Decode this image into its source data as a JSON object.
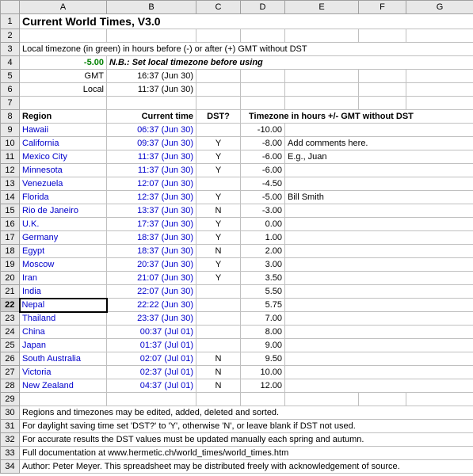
{
  "columns": [
    "A",
    "B",
    "C",
    "D",
    "E",
    "F",
    "G"
  ],
  "title": "Current World Times, V3.0",
  "note_line3": "Local timezone (in green) in hours before (-) or after (+) GMT without DST",
  "local_tz_value": "-5.00",
  "nb_text": "N.B.: Set local timezone before using",
  "gmt_label": "GMT",
  "gmt_time": "16:37 (Jun 30)",
  "local_label": "Local",
  "local_time": "11:37 (Jun 30)",
  "headers": {
    "region": "Region",
    "curtime": "Current time",
    "dst": "DST?",
    "tz": "Timezone in hours +/- GMT without DST"
  },
  "rows": [
    {
      "rn": "9",
      "region": "Hawaii",
      "time": "06:37 (Jun 30)",
      "dst": "",
      "tz": "-10.00",
      "comment": ""
    },
    {
      "rn": "10",
      "region": "California",
      "time": "09:37 (Jun 30)",
      "dst": "Y",
      "tz": "-8.00",
      "comment": "Add comments here."
    },
    {
      "rn": "11",
      "region": "Mexico City",
      "time": "11:37 (Jun 30)",
      "dst": "Y",
      "tz": "-6.00",
      "comment": "E.g., Juan"
    },
    {
      "rn": "12",
      "region": "Minnesota",
      "time": "11:37 (Jun 30)",
      "dst": "Y",
      "tz": "-6.00",
      "comment": ""
    },
    {
      "rn": "13",
      "region": "Venezuela",
      "time": "12:07 (Jun 30)",
      "dst": "",
      "tz": "-4.50",
      "comment": ""
    },
    {
      "rn": "14",
      "region": "Florida",
      "time": "12:37 (Jun 30)",
      "dst": "Y",
      "tz": "-5.00",
      "comment": "Bill Smith"
    },
    {
      "rn": "15",
      "region": "Rio de Janeiro",
      "time": "13:37 (Jun 30)",
      "dst": "N",
      "tz": "-3.00",
      "comment": ""
    },
    {
      "rn": "16",
      "region": "U.K.",
      "time": "17:37 (Jun 30)",
      "dst": "Y",
      "tz": "0.00",
      "comment": ""
    },
    {
      "rn": "17",
      "region": "Germany",
      "time": "18:37 (Jun 30)",
      "dst": "Y",
      "tz": "1.00",
      "comment": ""
    },
    {
      "rn": "18",
      "region": "Egypt",
      "time": "18:37 (Jun 30)",
      "dst": "N",
      "tz": "2.00",
      "comment": ""
    },
    {
      "rn": "19",
      "region": "Moscow",
      "time": "20:37 (Jun 30)",
      "dst": "Y",
      "tz": "3.00",
      "comment": ""
    },
    {
      "rn": "20",
      "region": "Iran",
      "time": "21:07 (Jun 30)",
      "dst": "Y",
      "tz": "3.50",
      "comment": ""
    },
    {
      "rn": "21",
      "region": "India",
      "time": "22:07 (Jun 30)",
      "dst": "",
      "tz": "5.50",
      "comment": ""
    },
    {
      "rn": "22",
      "region": "Nepal",
      "time": "22:22 (Jun 30)",
      "dst": "",
      "tz": "5.75",
      "comment": ""
    },
    {
      "rn": "23",
      "region": "Thailand",
      "time": "23:37 (Jun 30)",
      "dst": "",
      "tz": "7.00",
      "comment": ""
    },
    {
      "rn": "24",
      "region": "China",
      "time": "00:37 (Jul 01)",
      "dst": "",
      "tz": "8.00",
      "comment": ""
    },
    {
      "rn": "25",
      "region": "Japan",
      "time": "01:37 (Jul 01)",
      "dst": "",
      "tz": "9.00",
      "comment": ""
    },
    {
      "rn": "26",
      "region": "South Australia",
      "time": "02:07 (Jul 01)",
      "dst": "N",
      "tz": "9.50",
      "comment": ""
    },
    {
      "rn": "27",
      "region": "Victoria",
      "time": "02:37 (Jul 01)",
      "dst": "N",
      "tz": "10.00",
      "comment": ""
    },
    {
      "rn": "28",
      "region": "New Zealand",
      "time": "04:37 (Jul 01)",
      "dst": "N",
      "tz": "12.00",
      "comment": ""
    }
  ],
  "footer": {
    "l30": "Regions and timezones may be edited, added, deleted and sorted.",
    "l31": "For daylight saving time set 'DST?' to 'Y', otherwise 'N', or leave blank if DST not used.",
    "l32": "For accurate results the DST values must be updated manually each spring and autumn.",
    "l33": "Full documentation at www.hermetic.ch/world_times/world_times.htm",
    "l34": "Author: Peter Meyer. This spreadsheet may be distributed freely with acknowledgement of source."
  }
}
